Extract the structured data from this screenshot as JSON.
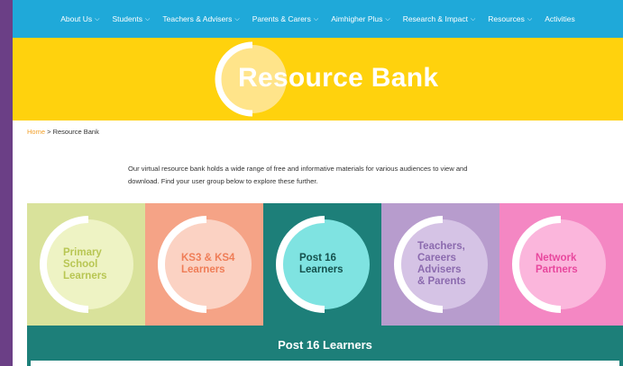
{
  "nav": {
    "items": [
      {
        "label": "About Us",
        "dropdown": true
      },
      {
        "label": "Students",
        "dropdown": true
      },
      {
        "label": "Teachers & Advisers",
        "dropdown": true
      },
      {
        "label": "Parents & Carers",
        "dropdown": true
      },
      {
        "label": "Aimhigher Plus",
        "dropdown": true
      },
      {
        "label": "Research & Impact",
        "dropdown": true
      },
      {
        "label": "Resources",
        "dropdown": true
      },
      {
        "label": "Activities",
        "dropdown": false
      }
    ],
    "chevron": "⌵"
  },
  "banner": {
    "title": "Resource Bank",
    "color": "#ffd20d"
  },
  "breadcrumb": {
    "home": "Home",
    "separator": " > ",
    "current": "Resource Bank"
  },
  "intro": {
    "line1": "Our virtual resource bank holds a wide range of free and informative materials for various audiences to view and",
    "line2": "download. Find your user group below to explore these further."
  },
  "tiles": [
    {
      "line1": "Primary",
      "line2": "School",
      "line3": "Learners",
      "line4": "",
      "bg": "#d9e29b",
      "circle": "#eef3c4",
      "text": "#b8c653"
    },
    {
      "line1": "KS3 & KS4",
      "line2": "Learners",
      "line3": "",
      "line4": "",
      "bg": "#f5a386",
      "circle": "#fbd2c3",
      "text": "#ef7d57"
    },
    {
      "line1": "Post 16",
      "line2": "Learners",
      "line3": "",
      "line4": "",
      "bg": "#1d7f79",
      "circle": "#7fe3e1",
      "text": "#15514d"
    },
    {
      "line1": "Teachers,",
      "line2": "Careers",
      "line3": "Advisers",
      "line4": "& Parents",
      "bg": "#b79ccd",
      "circle": "#d5c3e5",
      "text": "#8b6aae"
    },
    {
      "line1": "Network",
      "line2": "Partners",
      "line3": "",
      "line4": "",
      "bg": "#f487c3",
      "circle": "#fbb6dc",
      "text": "#e8489e"
    }
  ],
  "panel": {
    "title": "Post 16 Learners"
  }
}
